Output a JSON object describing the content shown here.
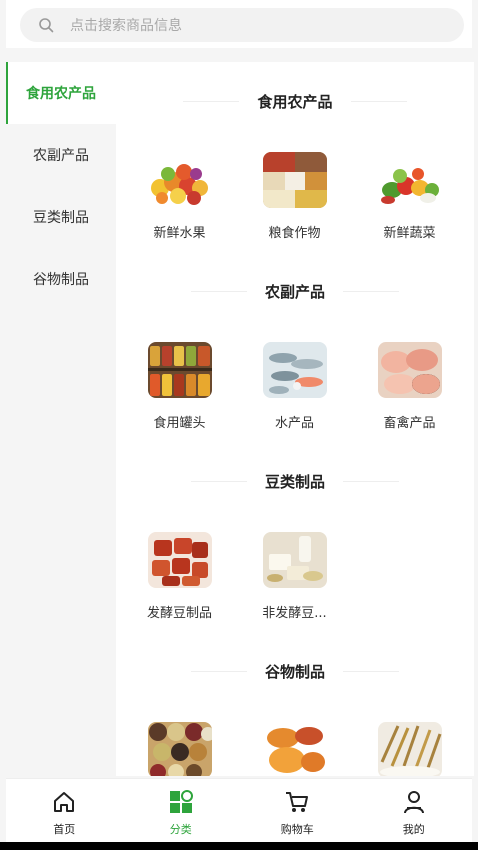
{
  "search": {
    "placeholder": "点击搜索商品信息"
  },
  "sidebar": {
    "items": [
      {
        "label": "食用农产品",
        "active": true
      },
      {
        "label": "农副产品"
      },
      {
        "label": "豆类制品"
      },
      {
        "label": "谷物制品"
      }
    ]
  },
  "sections": [
    {
      "title": "食用农产品",
      "items": [
        {
          "label": "新鲜水果",
          "icon": "fruit-image"
        },
        {
          "label": "粮食作物",
          "icon": "grain-image"
        },
        {
          "label": "新鲜蔬菜",
          "icon": "vegetable-image"
        }
      ]
    },
    {
      "title": "农副产品",
      "items": [
        {
          "label": "食用罐头",
          "icon": "canned-food-image"
        },
        {
          "label": "水产品",
          "icon": "seafood-image"
        },
        {
          "label": "畜禽产品",
          "icon": "meat-image"
        }
      ]
    },
    {
      "title": "豆类制品",
      "items": [
        {
          "label": "发酵豆制品",
          "icon": "fermented-tofu-image"
        },
        {
          "label": "非发酵豆...",
          "icon": "tofu-image"
        }
      ]
    },
    {
      "title": "谷物制品",
      "items": [
        {
          "icon": "beans-image"
        },
        {
          "icon": "sweet-potato-image"
        },
        {
          "icon": "wheat-image"
        }
      ]
    }
  ],
  "tabbar": {
    "items": [
      {
        "label": "首页",
        "icon": "home-icon"
      },
      {
        "label": "分类",
        "icon": "category-icon",
        "active": true
      },
      {
        "label": "购物车",
        "icon": "cart-icon"
      },
      {
        "label": "我的",
        "icon": "user-icon"
      }
    ]
  },
  "colors": {
    "accent": "#2ea43c",
    "background": "#f5f5f5"
  }
}
